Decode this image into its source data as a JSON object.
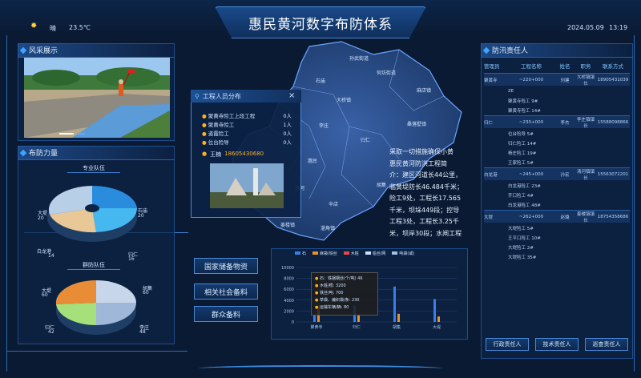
{
  "header": {
    "weather_label": "晴",
    "temperature": "23.5℃",
    "title": "惠民黄河数字布防体系",
    "date": "2024.05.09",
    "time": "13:19"
  },
  "left": {
    "scene_title": "风采展示",
    "deploy_title": "布防力量",
    "team1_title": "专业队伍",
    "team1": [
      {
        "label": "大堤",
        "value": "20"
      },
      {
        "label": "白龙港",
        "value": "14"
      },
      {
        "label": "归仁",
        "value": "16"
      },
      {
        "label": "石庙",
        "value": "20"
      }
    ],
    "team2_title": "群防队伍",
    "team2": [
      {
        "label": "大堤",
        "value": "60"
      },
      {
        "label": "归仁",
        "value": "42"
      },
      {
        "label": "李庄",
        "value": "48"
      },
      {
        "label": "胡集",
        "value": "60"
      }
    ]
  },
  "popup": {
    "title": "工程人员分布",
    "rows": [
      {
        "label": "聚黄寺险工上段工程",
        "value": "0人"
      },
      {
        "label": "聚黄寺险工",
        "value": "1人"
      },
      {
        "label": "道霞险工",
        "value": "0人"
      },
      {
        "label": "位台险导",
        "value": "0人"
      }
    ],
    "phone_label": "王楠",
    "phone": "18605430680",
    "close": "×"
  },
  "map": {
    "town_labels": [
      "石庙",
      "大桥镇",
      "李庄",
      "归仁",
      "麻店镇",
      "惠民",
      "清河",
      "辛店",
      "胡集",
      "姜楼镇",
      "淄角镇",
      "孙武街道",
      "何坊街道",
      "桑落墅镇"
    ],
    "intro_lines": [
      "采取一切措施确保小黄",
      "惠民黄河防洪工程简",
      "介：建区河道长44公里，",
      "临黄堤防长46.484千米；",
      "险工9处，工程长17.565",
      "千米，坝垛449段；控导",
      "工程3处，工程长3.25千",
      "米，坝岸30段；水闸工程"
    ]
  },
  "buttons": {
    "national": "国家储备物资",
    "social": "相关社会备料",
    "mass": "群众备料"
  },
  "chart_data": {
    "type": "bar",
    "legend": [
      "石",
      "麻袋/铁丝",
      "木桩",
      "铅丝/网",
      "吨袋(或)"
    ],
    "categories": [
      "聚黄寺",
      "归仁",
      "胡集",
      "大堤"
    ],
    "yticks": [
      "10000",
      "8000",
      "6000",
      "4000",
      "2000",
      "0"
    ],
    "ylim": [
      0,
      10000
    ],
    "series": [
      {
        "name": "石",
        "values": [
          1200,
          3000,
          6500,
          4200
        ]
      },
      {
        "name": "吨袋",
        "values": [
          3000,
          1200,
          1500,
          1000
        ]
      }
    ],
    "tooltip": [
      {
        "label": "石：",
        "text": "铁捆钢丝(个/吨)",
        "value": "46"
      },
      {
        "label": "木桩/根",
        "value": "3200"
      },
      {
        "label": "铁丝/吨",
        "value": "700"
      },
      {
        "label": "草袋、编织袋/条",
        "value": "230"
      },
      {
        "label": "运输车辆/辆",
        "value": "80"
      }
    ],
    "colors": [
      "#3b7de8",
      "#e8932d",
      "#e34a4a",
      "#c8dfff",
      "#9fc0e8"
    ]
  },
  "responsible": {
    "title": "防汛责任人",
    "columns": [
      "管理员",
      "工程名称",
      "姓名",
      "职务",
      "联系方式"
    ],
    "groups": [
      {
        "station": "聚黄寺",
        "code": "~220+000",
        "name": "刘建",
        "position": "大桥镇镇长",
        "phone": "18905431039",
        "items": [
          "ZE",
          "聚黄寺险工 9#",
          "聚黄寺险工 14#"
        ]
      },
      {
        "station": "归仁",
        "code": "~230+000",
        "name": "李杰",
        "position": "李庄镇镇长",
        "phone": "15588098866",
        "items": [
          "位台险导 5#",
          "归仁险工 14#",
          "杨庄险工 19#",
          "王家险工 5#"
        ]
      },
      {
        "station": "白龙港",
        "code": "~245+000",
        "name": "孙宏",
        "position": "清河镇镇长",
        "phone": "15563072201",
        "items": [
          "白龙港险工 23#",
          "齐口险工 4#",
          "白龙港险工 48#"
        ]
      },
      {
        "station": "大堤",
        "code": "~262+000",
        "name": "赵璐",
        "position": "姜楼镇镇长",
        "phone": "18754358686",
        "items": [
          "大堤险工 5#",
          "王平口险工 10#",
          "大堤险工 2#",
          "大堤险工 35#"
        ]
      }
    ],
    "buttons": [
      "行政责任人",
      "技术责任人",
      "巡查责任人"
    ]
  }
}
